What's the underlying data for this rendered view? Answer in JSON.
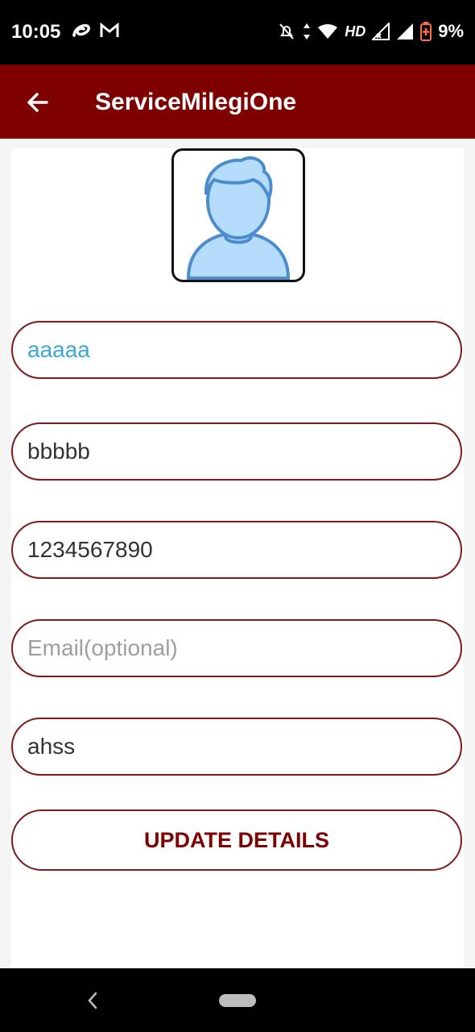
{
  "status_bar": {
    "time": "10:05",
    "network": "HD",
    "battery": "9%"
  },
  "app_bar": {
    "title": "ServiceMilegiOne"
  },
  "form": {
    "first_name": {
      "value": "aaaaa"
    },
    "last_name": {
      "value": "bbbbb"
    },
    "phone": {
      "value": "1234567890"
    },
    "email": {
      "value": "",
      "placeholder": "Email(optional)"
    },
    "address": {
      "value": "ahss"
    }
  },
  "update_button_label": "UPDATE DETAILS",
  "colors": {
    "primary": "#7f0000",
    "field_border": "#7f1a1a",
    "active_text": "#3aa9dc"
  },
  "icons": {
    "back": "back-arrow-icon",
    "avatar": "user-avatar-icon"
  }
}
